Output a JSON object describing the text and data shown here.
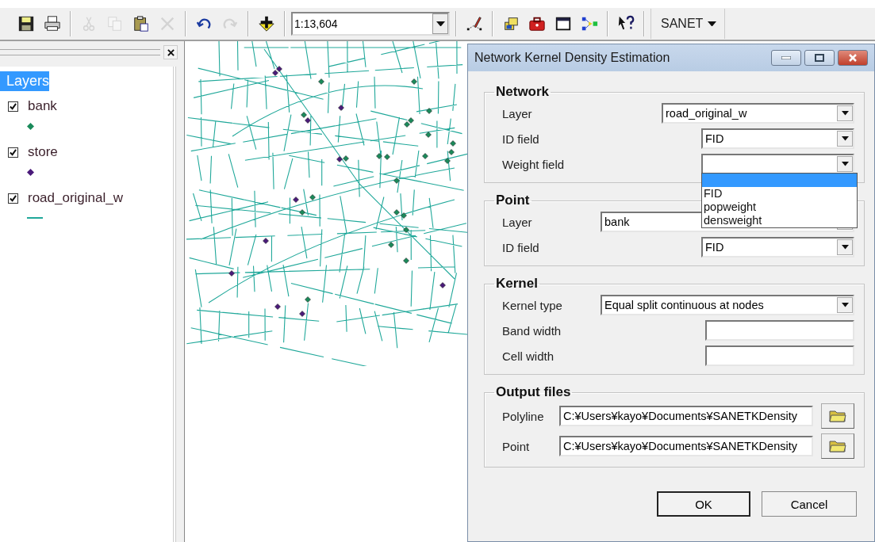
{
  "toolbar": {
    "items": [
      {
        "kind": "button",
        "disabled": false
      },
      {
        "kind": "button",
        "disabled": false
      },
      {
        "kind": "separator"
      },
      {
        "kind": "button",
        "disabled": true
      },
      {
        "kind": "button",
        "disabled": true
      },
      {
        "kind": "button",
        "disabled": false
      },
      {
        "kind": "button",
        "disabled": true
      },
      {
        "kind": "separator"
      },
      {
        "kind": "button",
        "disabled": false
      },
      {
        "kind": "button",
        "disabled": true
      },
      {
        "kind": "separator"
      },
      {
        "kind": "button",
        "disabled": false
      },
      {
        "kind": "separator"
      },
      {
        "kind": "combo",
        "value": "1:13,604"
      },
      {
        "kind": "separator"
      },
      {
        "kind": "button",
        "disabled": false
      },
      {
        "kind": "separator"
      },
      {
        "kind": "button",
        "disabled": false
      },
      {
        "kind": "button",
        "disabled": false
      },
      {
        "kind": "button",
        "disabled": false
      },
      {
        "kind": "button",
        "disabled": false
      },
      {
        "kind": "separator"
      },
      {
        "kind": "button",
        "disabled": false
      },
      {
        "kind": "separator"
      },
      {
        "kind": "menu",
        "label": "SANET"
      }
    ]
  },
  "toc": {
    "title": "Layers",
    "title_selected": true,
    "layers": [
      {
        "name": "bank",
        "checked": true,
        "kind": "point",
        "color": "#1a8a5a"
      },
      {
        "name": "store",
        "checked": true,
        "kind": "point",
        "color": "#4a1a7a"
      },
      {
        "name": "road_original_w",
        "checked": true,
        "kind": "line",
        "color": "#20a89a"
      }
    ]
  },
  "dialog": {
    "title": "Network Kernel Density Estimation",
    "groups": [
      {
        "title": "Network",
        "rows": [
          {
            "kind": "wide-combo",
            "label": "Layer",
            "value": "road_original_w"
          },
          {
            "kind": "combo",
            "label": "ID field",
            "value": "FID"
          },
          {
            "kind": "combo",
            "label": "Weight field",
            "expanded": true,
            "options": [
              {
                "selected": true
              },
              {
                "label": "FID",
                "selected": false
              },
              {
                "label": "popweight",
                "selected": false
              },
              {
                "label": "densweight",
                "selected": false
              }
            ]
          }
        ]
      },
      {
        "title": "Point",
        "rows": [
          {
            "kind": "long-combo",
            "label": "Layer",
            "value": "bank"
          },
          {
            "kind": "combo",
            "label": "ID field",
            "value": "FID"
          }
        ]
      },
      {
        "title": "Kernel",
        "rows": [
          {
            "kind": "long-combo",
            "label": "Kernel type",
            "value": "Equal split continuous at nodes"
          },
          {
            "kind": "text",
            "label": "Band width"
          },
          {
            "kind": "text",
            "label": "Cell width"
          }
        ]
      },
      {
        "title": "Output files",
        "rows": [
          {
            "kind": "file",
            "label": "Polyline",
            "value": "C:¥Users¥kayo¥Documents¥SANETKDensity"
          },
          {
            "kind": "file",
            "label": "Point",
            "value": "C:¥Users¥kayo¥Documents¥SANETKDensity"
          }
        ]
      }
    ],
    "buttons": [
      {
        "label": "OK",
        "default": true
      },
      {
        "label": "Cancel",
        "default": false
      }
    ]
  }
}
